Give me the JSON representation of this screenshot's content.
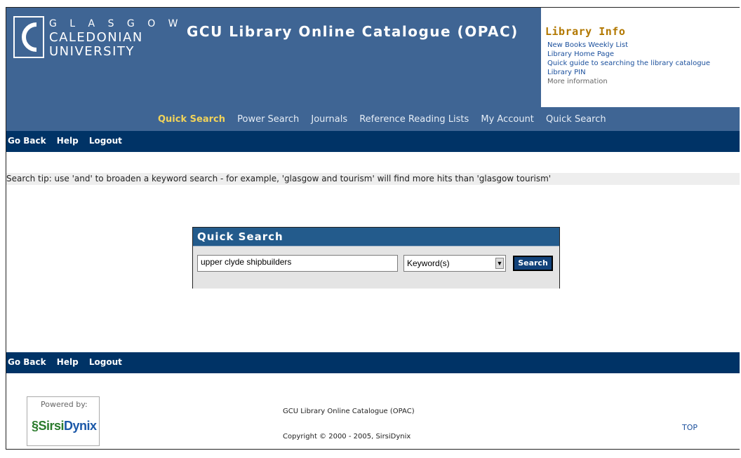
{
  "header": {
    "logo": {
      "line1": "G L A S G O W",
      "line2": "CALEDONIAN",
      "line3": "UNIVERSITY"
    },
    "title": "GCU Library Online Catalogue (OPAC)",
    "brand_color": "#3f6594"
  },
  "library_info": {
    "title": "Library Info",
    "links": [
      "New Books Weekly List",
      "Library Home Page",
      "Quick guide to searching the library catalogue",
      "Library PIN"
    ],
    "more": "More information"
  },
  "nav": {
    "items": [
      "Quick Search",
      "Power Search",
      "Journals",
      "Reference Reading Lists",
      "My Account",
      "Quick Search"
    ],
    "active_index": 0
  },
  "toolbar": {
    "go_back": "Go Back",
    "help": "Help",
    "logout": "Logout"
  },
  "tip": "Search tip: use 'and' to broaden a keyword search - for example, 'glasgow and tourism' will find more hits than 'glasgow tourism'",
  "quick_search": {
    "title": "Quick Search",
    "query": "upper clyde shipbuilders",
    "type_selected": "Keyword(s)",
    "button": "Search"
  },
  "footer": {
    "powered_by": "Powered by:",
    "brand_sirsi": "Sirsi",
    "brand_dynix": "Dynix",
    "catalogue_name": "GCU Library Online Catalogue (OPAC)",
    "copyright": "Copyright © 2000 - 2005, SirsiDynix",
    "top": "TOP"
  }
}
